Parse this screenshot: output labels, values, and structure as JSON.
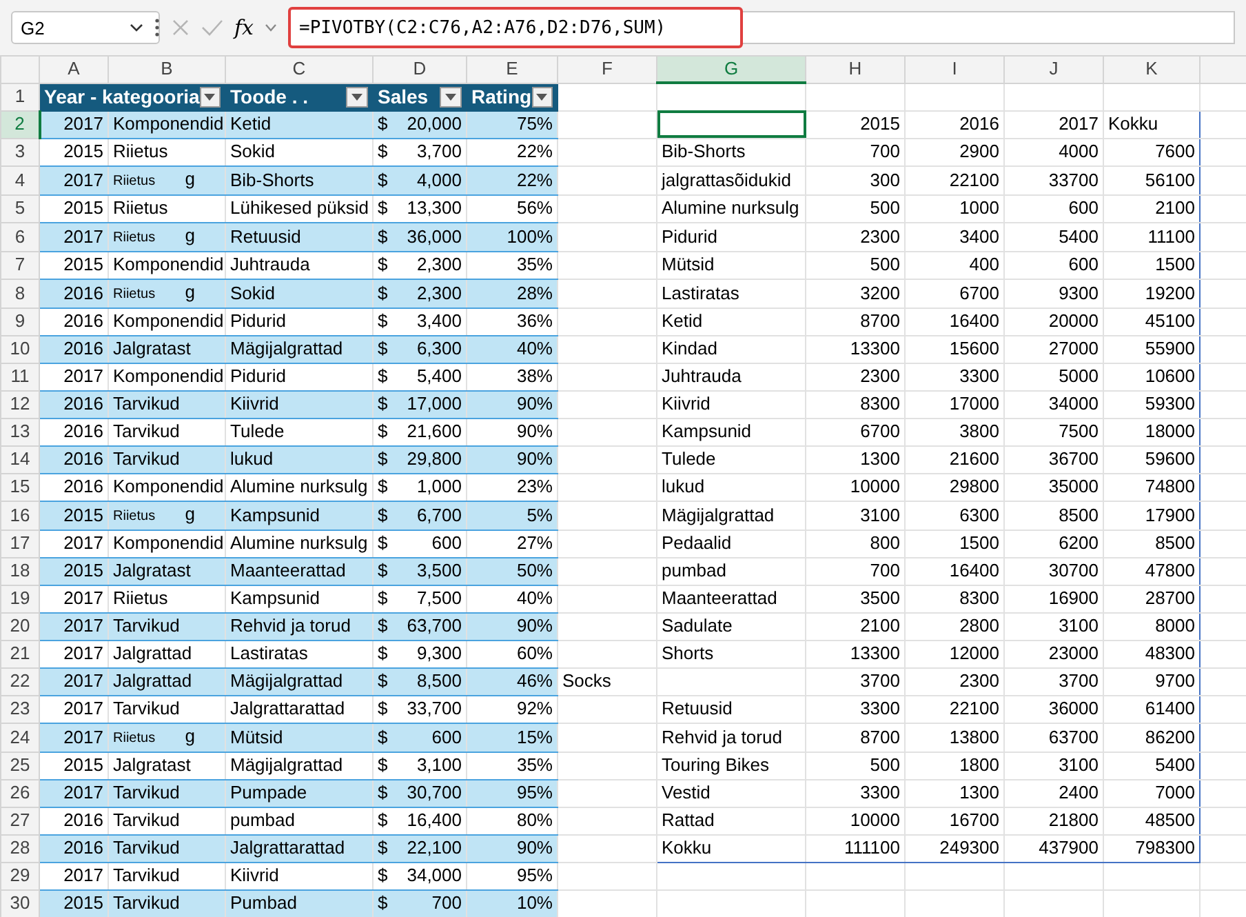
{
  "name_box": {
    "value": "G2"
  },
  "formula_bar": {
    "fx_label": "fx",
    "formula": "=PIVOTBY(C2:C76,A2:A76,D2:D76,SUM)",
    "highlighted": true
  },
  "columns": [
    {
      "label": "A",
      "selected": false
    },
    {
      "label": "B",
      "selected": false
    },
    {
      "label": "C",
      "selected": false
    },
    {
      "label": "D",
      "selected": false
    },
    {
      "label": "E",
      "selected": false
    },
    {
      "label": "F",
      "selected": false
    },
    {
      "label": "G",
      "selected": true
    },
    {
      "label": "H",
      "selected": false
    },
    {
      "label": "I",
      "selected": false
    },
    {
      "label": "J",
      "selected": false
    },
    {
      "label": "K",
      "selected": false
    }
  ],
  "row_headers": [
    {
      "label": "1",
      "selected": false
    },
    {
      "label": "2",
      "selected": true
    },
    {
      "label": "3",
      "selected": false
    },
    {
      "label": "4",
      "selected": false
    },
    {
      "label": "5",
      "selected": false
    },
    {
      "label": "6",
      "selected": false
    },
    {
      "label": "7",
      "selected": false
    },
    {
      "label": "8",
      "selected": false
    },
    {
      "label": "9",
      "selected": false
    },
    {
      "label": "10",
      "selected": false
    },
    {
      "label": "11",
      "selected": false
    },
    {
      "label": "12",
      "selected": false
    },
    {
      "label": "13",
      "selected": false
    },
    {
      "label": "14",
      "selected": false
    },
    {
      "label": "15",
      "selected": false
    },
    {
      "label": "16",
      "selected": false
    },
    {
      "label": "17",
      "selected": false
    },
    {
      "label": "18",
      "selected": false
    },
    {
      "label": "19",
      "selected": false
    },
    {
      "label": "20",
      "selected": false
    },
    {
      "label": "21",
      "selected": false
    },
    {
      "label": "22",
      "selected": false
    },
    {
      "label": "23",
      "selected": false
    },
    {
      "label": "24",
      "selected": false
    },
    {
      "label": "25",
      "selected": false
    },
    {
      "label": "26",
      "selected": false
    },
    {
      "label": "27",
      "selected": false
    },
    {
      "label": "28",
      "selected": false
    },
    {
      "label": "29",
      "selected": false
    },
    {
      "label": "30",
      "selected": false
    }
  ],
  "sales_table": {
    "headers": [
      "Year - kategooria",
      "Toode . .",
      "Sales",
      "Rating"
    ],
    "rows": [
      {
        "year": "2017",
        "category": "Komponendid",
        "product": "Ketid",
        "currency": "$",
        "sales": "20,000",
        "rating": "75%"
      },
      {
        "year": "2015",
        "category": "Riietus",
        "product": "Sokid",
        "currency": "$",
        "sales": "3,700",
        "rating": "22%"
      },
      {
        "year": "2017",
        "category": "Riietus",
        "category_tail": "g",
        "product": "Bib-Shorts",
        "currency": "$",
        "sales": "4,000",
        "rating": "22%"
      },
      {
        "year": "2015",
        "category": "Riietus",
        "product": "Lühikesed püksid",
        "currency": "$",
        "sales": "13,300",
        "rating": "56%"
      },
      {
        "year": "2017",
        "category": "Riietus",
        "category_tail": "g",
        "product": "Retuusid",
        "currency": "$",
        "sales": "36,000",
        "rating": "100%"
      },
      {
        "year": "2015",
        "category": "Komponendid",
        "product": "Juhtrauda",
        "currency": "$",
        "sales": "2,300",
        "rating": "35%"
      },
      {
        "year": "2016",
        "category": "Riietus",
        "category_tail": "g",
        "product": "Sokid",
        "currency": "$",
        "sales": "2,300",
        "rating": "28%"
      },
      {
        "year": "2016",
        "category": "Komponendid",
        "product": "Pidurid",
        "currency": "$",
        "sales": "3,400",
        "rating": "36%"
      },
      {
        "year": "2016",
        "category": "Jalgratast",
        "product": "Mägijalgrattad",
        "currency": "$",
        "sales": "6,300",
        "rating": "40%"
      },
      {
        "year": "2017",
        "category": "Komponendid",
        "product": "Pidurid",
        "currency": "$",
        "sales": "5,400",
        "rating": "38%"
      },
      {
        "year": "2016",
        "category": "Tarvikud",
        "product": "Kiivrid",
        "currency": "$",
        "sales": "17,000",
        "rating": "90%"
      },
      {
        "year": "2016",
        "category": "Tarvikud",
        "product": "Tulede",
        "currency": "$",
        "sales": "21,600",
        "rating": "90%"
      },
      {
        "year": "2016",
        "category": "Tarvikud",
        "product": "lukud",
        "currency": "$",
        "sales": "29,800",
        "rating": "90%"
      },
      {
        "year": "2016",
        "category": "Komponendid",
        "product": "Alumine nurksulg",
        "currency": "$",
        "sales": "1,000",
        "rating": "23%"
      },
      {
        "year": "2015",
        "category": "Riietus",
        "category_tail": "g",
        "product": "Kampsunid",
        "currency": "$",
        "sales": "6,700",
        "rating": "5%"
      },
      {
        "year": "2017",
        "category": "Komponendid",
        "product": "Alumine nurksulg",
        "currency": "$",
        "sales": "600",
        "rating": "27%"
      },
      {
        "year": "2015",
        "category": "Jalgratast",
        "product": "Maanteerattad",
        "currency": "$",
        "sales": "3,500",
        "rating": "50%"
      },
      {
        "year": "2017",
        "category": "Riietus",
        "product": "Kampsunid",
        "currency": "$",
        "sales": "7,500",
        "rating": "40%"
      },
      {
        "year": "2017",
        "category": "Tarvikud",
        "product": "Rehvid ja torud",
        "currency": "$",
        "sales": "63,700",
        "rating": "90%"
      },
      {
        "year": "2017",
        "category": "Jalgrattad",
        "product": "Lastiratas",
        "currency": "$",
        "sales": "9,300",
        "rating": "60%"
      },
      {
        "year": "2017",
        "category": "Jalgrattad",
        "product": "Mägijalgrattad",
        "currency": "$",
        "sales": "8,500",
        "rating": "46%",
        "note": "Socks"
      },
      {
        "year": "2017",
        "category": "Tarvikud",
        "product": "Jalgrattarattad",
        "currency": "$",
        "sales": "33,700",
        "rating": "92%"
      },
      {
        "year": "2017",
        "category": "Riietus",
        "category_tail": "g",
        "product": "Mütsid",
        "currency": "$",
        "sales": "600",
        "rating": "15%"
      },
      {
        "year": "2015",
        "category": "Jalgratast",
        "product": "Mägijalgrattad",
        "currency": "$",
        "sales": "3,100",
        "rating": "35%"
      },
      {
        "year": "2017",
        "category": "Tarvikud",
        "product": "Pumpade",
        "currency": "$",
        "sales": "30,700",
        "rating": "95%"
      },
      {
        "year": "2016",
        "category": "Tarvikud",
        "product": "pumbad",
        "currency": "$",
        "sales": "16,400",
        "rating": "80%"
      },
      {
        "year": "2016",
        "category": "Tarvikud",
        "product": "Jalgrattarattad",
        "currency": "$",
        "sales": "22,100",
        "rating": "90%"
      },
      {
        "year": "2017",
        "category": "Tarvikud",
        "product": "Kiivrid",
        "currency": "$",
        "sales": "34,000",
        "rating": "95%"
      },
      {
        "year": "2015",
        "category": "Tarvikud",
        "product": "Pumbad",
        "currency": "$",
        "sales": "700",
        "rating": "10%"
      }
    ]
  },
  "pivot_table": {
    "headers": [
      "2015",
      "2016",
      "2017",
      "Kokku"
    ],
    "rows": [
      {
        "label": "Bib-Shorts",
        "values": [
          "700",
          "2900",
          "4000",
          "7600"
        ]
      },
      {
        "label": "jalgrattasõidukid",
        "values": [
          "300",
          "22100",
          "33700",
          "56100"
        ]
      },
      {
        "label": "Alumine nurksulg",
        "values": [
          "500",
          "1000",
          "600",
          "2100"
        ]
      },
      {
        "label": "Pidurid",
        "values": [
          "2300",
          "3400",
          "5400",
          "11100"
        ]
      },
      {
        "label": "Mütsid",
        "values": [
          "500",
          "400",
          "600",
          "1500"
        ]
      },
      {
        "label": "Lastiratas",
        "values": [
          "3200",
          "6700",
          "9300",
          "19200"
        ]
      },
      {
        "label": "Ketid",
        "values": [
          "8700",
          "16400",
          "20000",
          "45100"
        ]
      },
      {
        "label": "Kindad",
        "values": [
          "13300",
          "15600",
          "27000",
          "55900"
        ]
      },
      {
        "label": "Juhtrauda",
        "values": [
          "2300",
          "3300",
          "5000",
          "10600"
        ]
      },
      {
        "label": "Kiivrid",
        "values": [
          "8300",
          "17000",
          "34000",
          "59300"
        ]
      },
      {
        "label": "Kampsunid",
        "values": [
          "6700",
          "3800",
          "7500",
          "18000"
        ]
      },
      {
        "label": "Tulede",
        "values": [
          "1300",
          "21600",
          "36700",
          "59600"
        ]
      },
      {
        "label": "lukud",
        "values": [
          "10000",
          "29800",
          "35000",
          "74800"
        ]
      },
      {
        "label": "Mägijalgrattad",
        "values": [
          "3100",
          "6300",
          "8500",
          "17900"
        ]
      },
      {
        "label": "Pedaalid",
        "values": [
          "800",
          "1500",
          "6200",
          "8500"
        ]
      },
      {
        "label": "pumbad",
        "values": [
          "700",
          "16400",
          "30700",
          "47800"
        ]
      },
      {
        "label": "Maanteerattad",
        "values": [
          "3500",
          "8300",
          "16900",
          "28700"
        ]
      },
      {
        "label": "Sadulate",
        "values": [
          "2100",
          "2800",
          "3100",
          "8000"
        ]
      },
      {
        "label": "Shorts",
        "values": [
          "13300",
          "12000",
          "23000",
          "48300"
        ]
      },
      {
        "values": [
          "3700",
          "2300",
          "3700",
          "9700"
        ]
      },
      {
        "label": "Retuusid",
        "values": [
          "3300",
          "22100",
          "36000",
          "61400"
        ]
      },
      {
        "label": "Rehvid ja torud",
        "values": [
          "8700",
          "13800",
          "63700",
          "86200"
        ]
      },
      {
        "label": "Touring Bikes",
        "values": [
          "500",
          "1800",
          "3100",
          "5400"
        ]
      },
      {
        "label": "Vestid",
        "values": [
          "3300",
          "1300",
          "2400",
          "7000"
        ]
      },
      {
        "label": "Rattad",
        "values": [
          "10000",
          "16700",
          "21800",
          "48500"
        ]
      },
      {
        "label": "Kokku",
        "values": [
          "111100",
          "249300",
          "437900",
          "798300"
        ]
      }
    ]
  }
}
